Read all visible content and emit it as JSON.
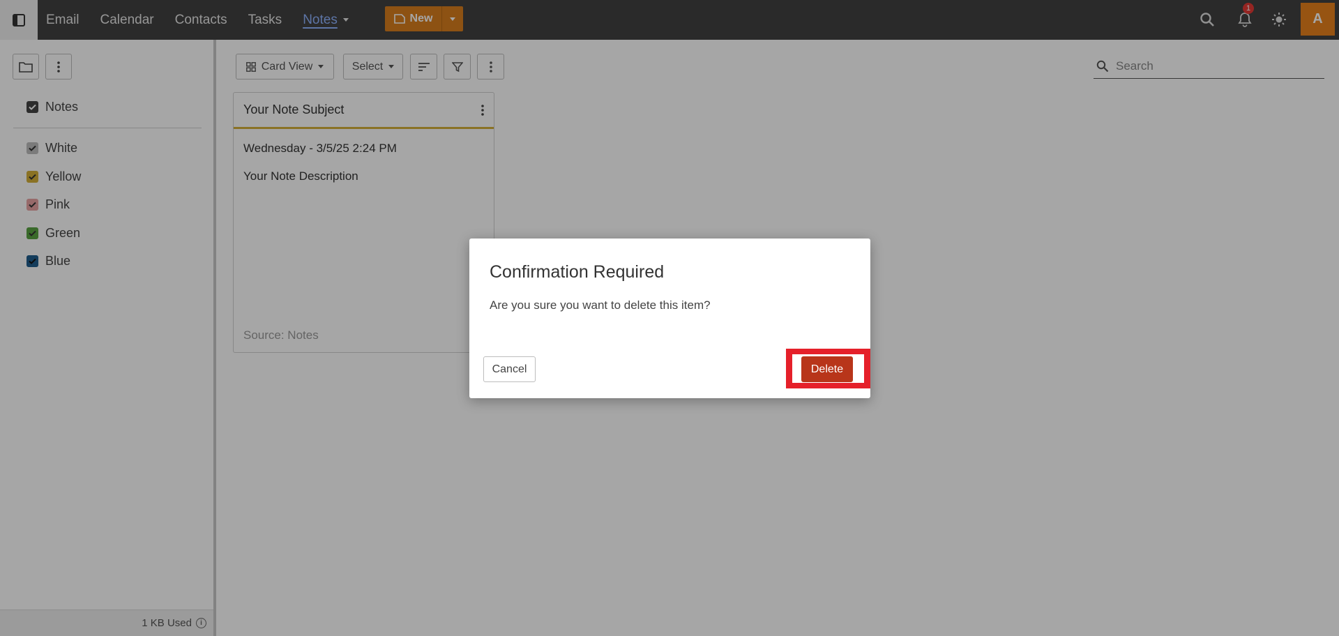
{
  "topbar": {
    "nav": [
      "Email",
      "Calendar",
      "Contacts",
      "Tasks",
      "Notes"
    ],
    "active_nav": "Notes",
    "new_label": "New",
    "notification_count": "1",
    "avatar_initial": "A",
    "accent_color": "#d97f1e"
  },
  "sidebar": {
    "folder_label": "Notes",
    "colors": [
      {
        "label": "White",
        "color": "#bdbdbd"
      },
      {
        "label": "Yellow",
        "color": "#d4b03a"
      },
      {
        "label": "Pink",
        "color": "#e8a3a3"
      },
      {
        "label": "Green",
        "color": "#5aa343"
      },
      {
        "label": "Blue",
        "color": "#1f5d8c"
      }
    ],
    "usage": "1 KB Used"
  },
  "toolbar": {
    "view_label": "Card View",
    "select_label": "Select",
    "search_placeholder": "Search"
  },
  "note": {
    "subject": "Your Note Subject",
    "date": "Wednesday - 3/5/25 2:24 PM",
    "description": "Your Note Description",
    "source": "Source: Notes"
  },
  "dialog": {
    "title": "Confirmation Required",
    "message": "Are you sure you want to delete this item?",
    "cancel_label": "Cancel",
    "delete_label": "Delete"
  }
}
